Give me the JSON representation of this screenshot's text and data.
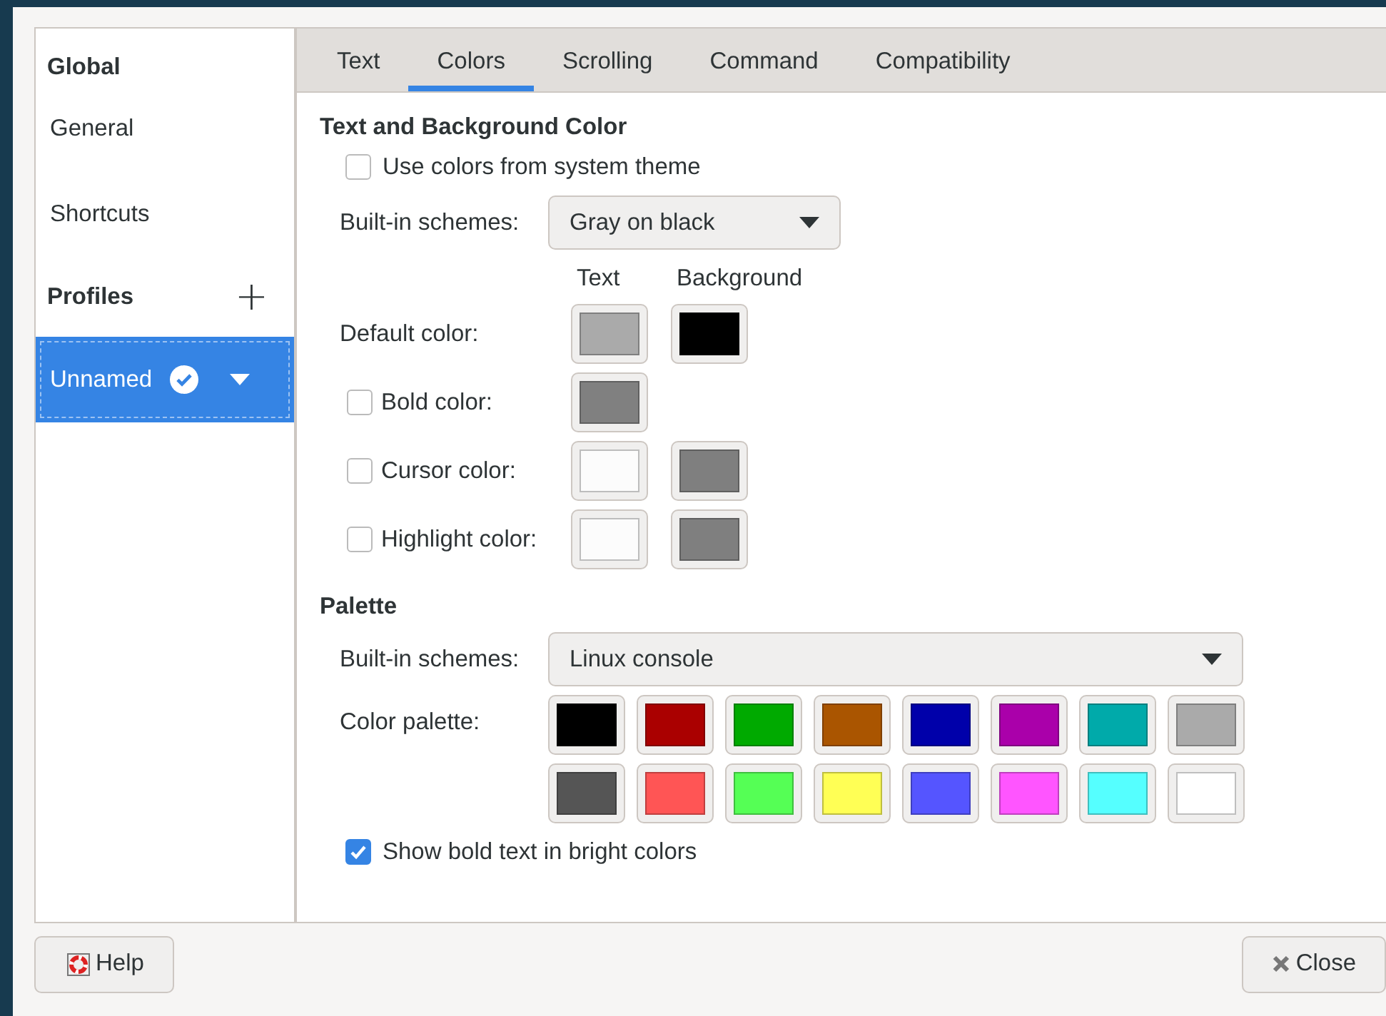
{
  "sidebar": {
    "global_heading": "Global",
    "items": [
      {
        "label": "General",
        "selected": false
      },
      {
        "label": "Shortcuts",
        "selected": false
      }
    ],
    "profiles_heading": "Profiles",
    "add_button": "+",
    "profiles": [
      {
        "label": "Unnamed",
        "selected": true,
        "default": true
      }
    ]
  },
  "tabs": [
    {
      "label": "Text",
      "selected": false
    },
    {
      "label": "Colors",
      "selected": true
    },
    {
      "label": "Scrolling",
      "selected": false
    },
    {
      "label": "Command",
      "selected": false
    },
    {
      "label": "Compatibility",
      "selected": false
    }
  ],
  "text_and_background": {
    "heading": "Text and Background Color",
    "use_system_colors": {
      "label": "Use colors from system theme",
      "checked": false
    },
    "schemes_label": "Built-in schemes:",
    "scheme": "Gray on black",
    "column_headers": [
      "Text",
      "Background"
    ],
    "rows": [
      {
        "kind": "plain",
        "label": "Default color:",
        "text_swatch": {
          "color": "#aaaaaa"
        },
        "background_swatch": {
          "color": "#000000"
        }
      },
      {
        "kind": "checkbox",
        "label": "Bold color:",
        "checked": false,
        "text_swatch": {
          "color": "#808080"
        }
      },
      {
        "kind": "checkbox",
        "label": "Cursor color:",
        "checked": false,
        "text_swatch": {
          "color": "#fcfcfc"
        },
        "background_swatch": {
          "color": "#7f7f7f"
        }
      },
      {
        "kind": "checkbox",
        "label": "Highlight color:",
        "checked": false,
        "text_swatch": {
          "color": "#fcfcfc"
        },
        "background_swatch": {
          "color": "#7f7f7f"
        }
      }
    ]
  },
  "palette": {
    "heading": "Palette",
    "schemes_label": "Built-in schemes:",
    "scheme": "Linux console",
    "palette_label": "Color palette:",
    "colors": [
      {
        "color": "#000000"
      },
      {
        "color": "#aa0000"
      },
      {
        "color": "#00aa00"
      },
      {
        "color": "#aa5500"
      },
      {
        "color": "#0000aa"
      },
      {
        "color": "#aa00aa"
      },
      {
        "color": "#00aaaa"
      },
      {
        "color": "#aaaaaa"
      },
      {
        "color": "#555555"
      },
      {
        "color": "#ff5555"
      },
      {
        "color": "#55ff55"
      },
      {
        "color": "#ffff55"
      },
      {
        "color": "#5555ff"
      },
      {
        "color": "#ff55ff"
      },
      {
        "color": "#55ffff"
      },
      {
        "color": "#ffffff"
      }
    ],
    "bold_bright": {
      "label": "Show bold text in bright colors",
      "checked": true
    }
  },
  "buttons": [
    {
      "kind": "help",
      "label": "Help"
    },
    {
      "kind": "close",
      "label": "Close"
    }
  ]
}
